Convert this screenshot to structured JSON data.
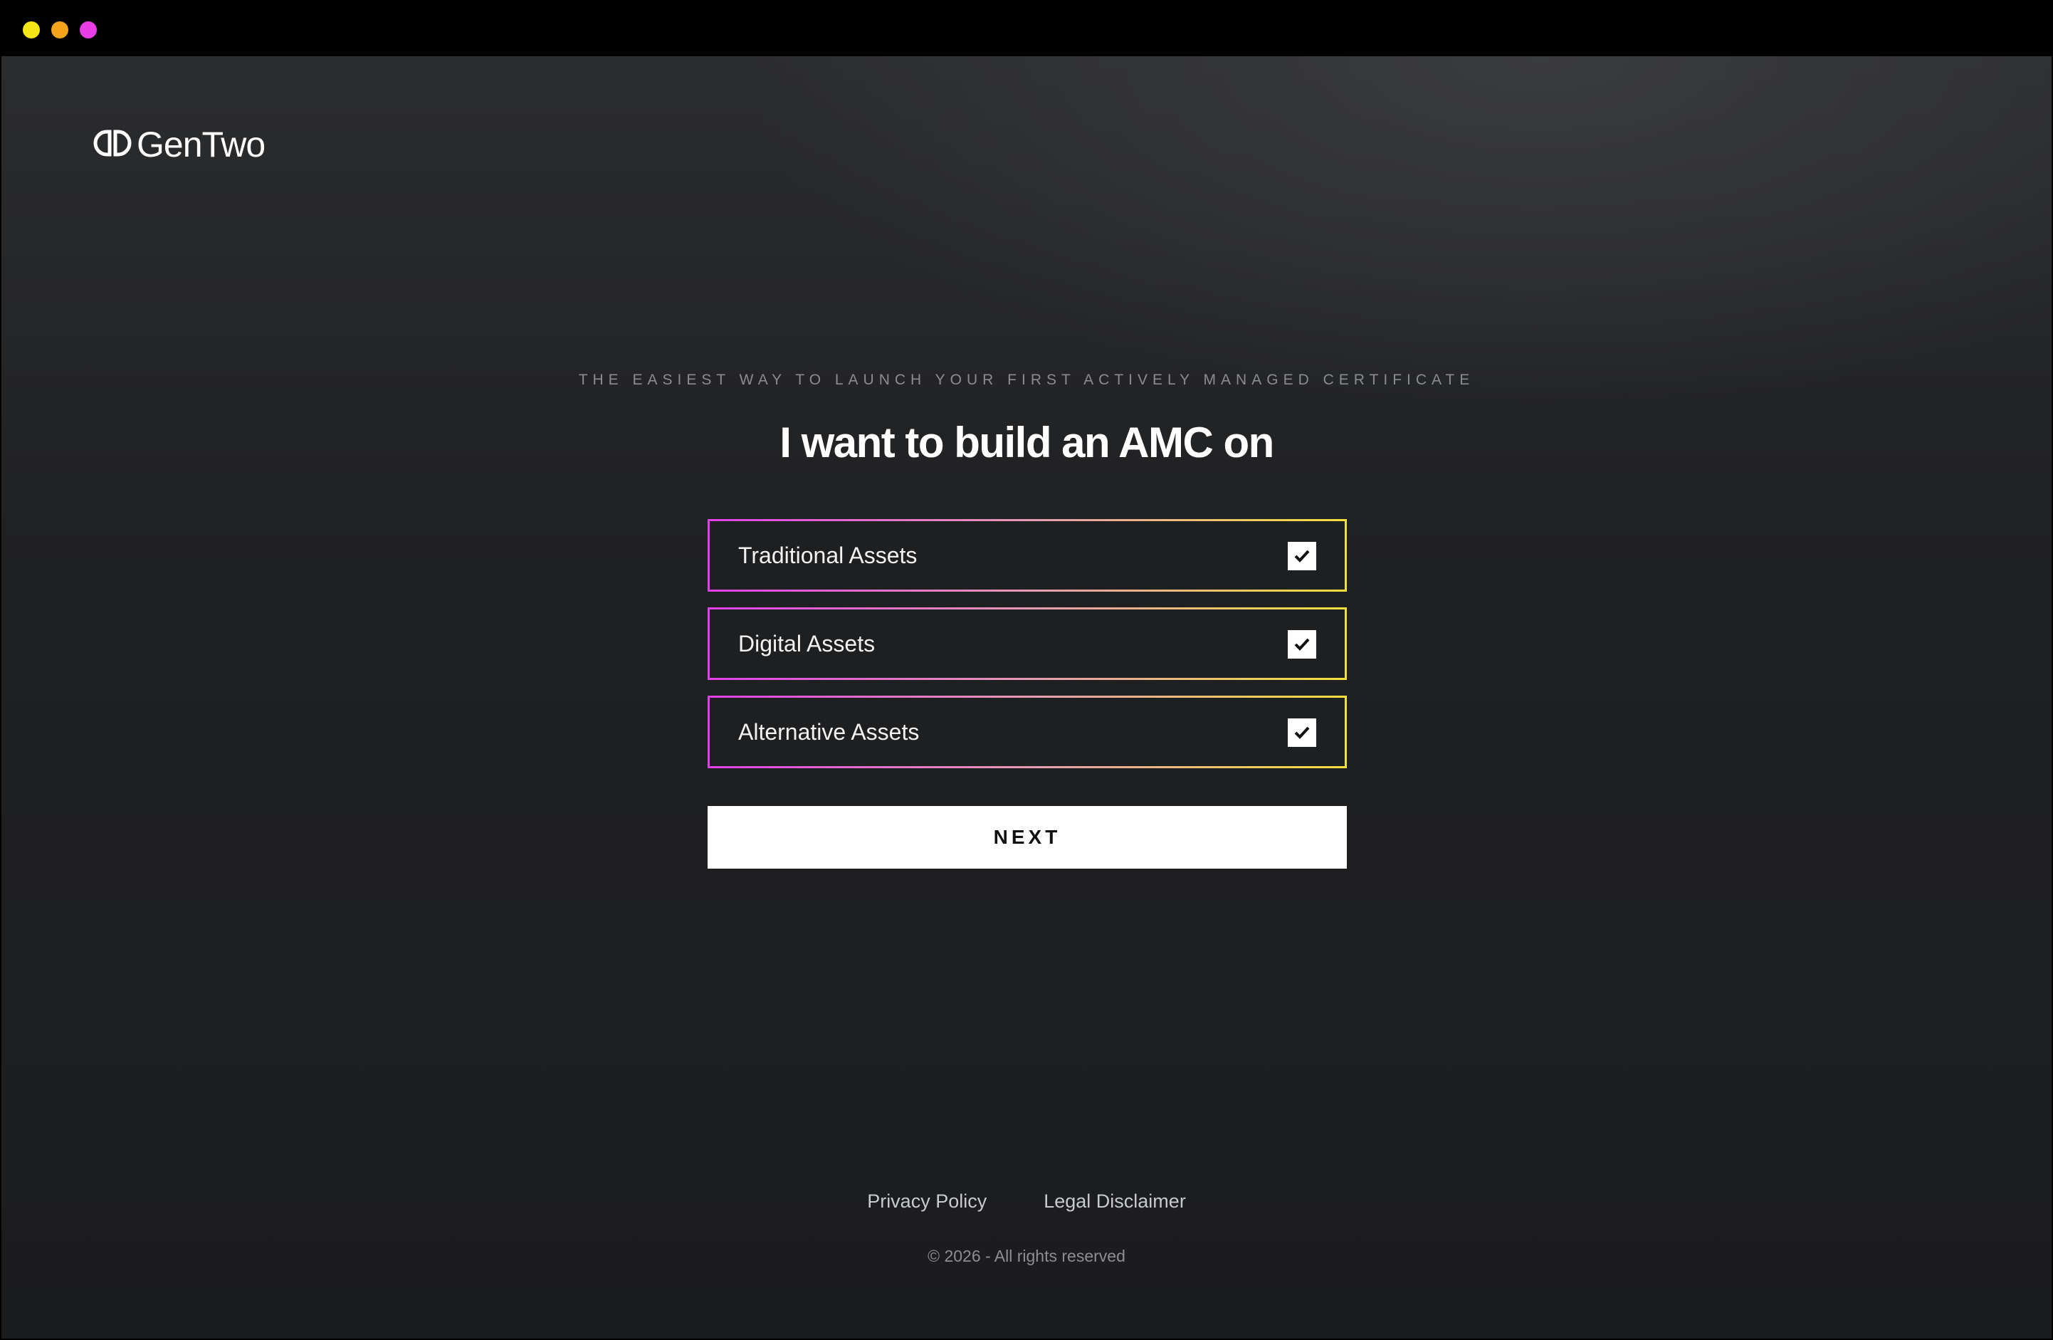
{
  "window": {
    "controls": [
      "yellow-dot",
      "orange-dot",
      "magenta-dot"
    ]
  },
  "brand": {
    "name": "GenTwo",
    "icon": "gentwo-logo-icon"
  },
  "hero": {
    "tagline": "THE EASIEST WAY TO LAUNCH YOUR FIRST ACTIVELY MANAGED CERTIFICATE",
    "heading": "I want to build an AMC on"
  },
  "options": [
    {
      "label": "Traditional Assets",
      "checked": true
    },
    {
      "label": "Digital Assets",
      "checked": true
    },
    {
      "label": "Alternative Assets",
      "checked": true
    }
  ],
  "actions": {
    "next_label": "NEXT"
  },
  "footer": {
    "privacy_label": "Privacy Policy",
    "legal_label": "Legal Disclaimer",
    "copyright": "© 2026 - All rights reserved"
  },
  "colors": {
    "background": "#1e1f21",
    "accent_magenta": "#e040e8",
    "accent_yellow": "#f2e03a",
    "button_bg": "#ffffff"
  }
}
